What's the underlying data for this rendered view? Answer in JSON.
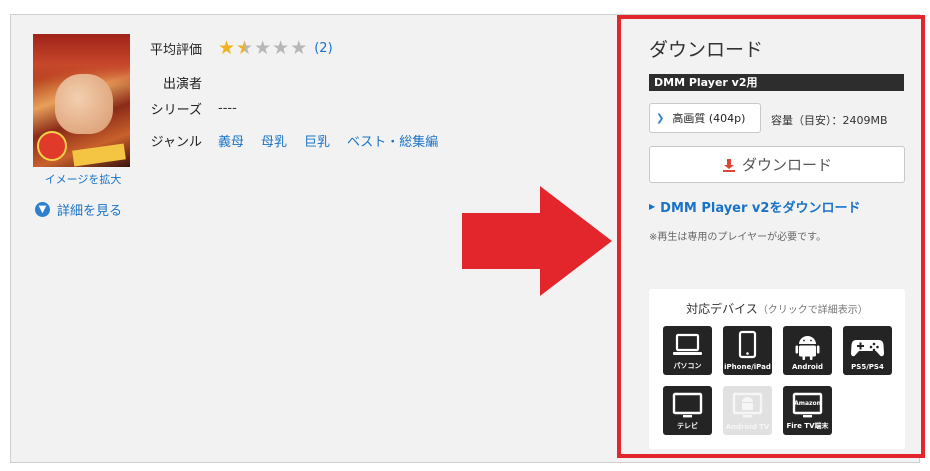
{
  "product": {
    "zoom_link": "イメージを拡大",
    "rating_label": "平均評価",
    "rating_value": 1.5,
    "rating_max": 5,
    "rating_count": "(2)",
    "cast_label": "出演者",
    "series_label": "シリーズ",
    "series_value": "----",
    "genre_label": "ジャンル",
    "genres": [
      "義母",
      "母乳",
      "巨乳",
      "ベスト・総集編"
    ],
    "detail_link": "詳細を見る"
  },
  "download": {
    "title": "ダウンロード",
    "player_bar": "DMM Player v2用",
    "quality": "高画質 (404p)",
    "size": "容量（目安）：2409MB",
    "button": "ダウンロード",
    "player_link": "DMM Player v2をダウンロード",
    "note": "※再生は専用のプレイヤーが必要です。",
    "devices_title": "対応デバイス",
    "devices_sub": "（クリックで詳細表示）",
    "devices": [
      {
        "label": "パソコン",
        "icon": "laptop-icon",
        "enabled": true
      },
      {
        "label": "iPhone/iPad",
        "icon": "phone-icon",
        "enabled": true
      },
      {
        "label": "Android",
        "icon": "android-icon",
        "enabled": true
      },
      {
        "label": "PS5/PS4",
        "icon": "gamepad-icon",
        "enabled": true
      },
      {
        "label": "テレビ",
        "icon": "tv-icon",
        "enabled": true
      },
      {
        "label": "Android TV",
        "icon": "android-tv-icon",
        "enabled": false
      },
      {
        "label": "Fire TV端末",
        "icon": "fire-tv-icon",
        "enabled": true,
        "screen_text": "Amazon"
      }
    ]
  },
  "colors": {
    "highlight_border": "#e3262b",
    "arrow": "#e3262b",
    "link": "#1a73c7",
    "star": "#f2b21b"
  }
}
